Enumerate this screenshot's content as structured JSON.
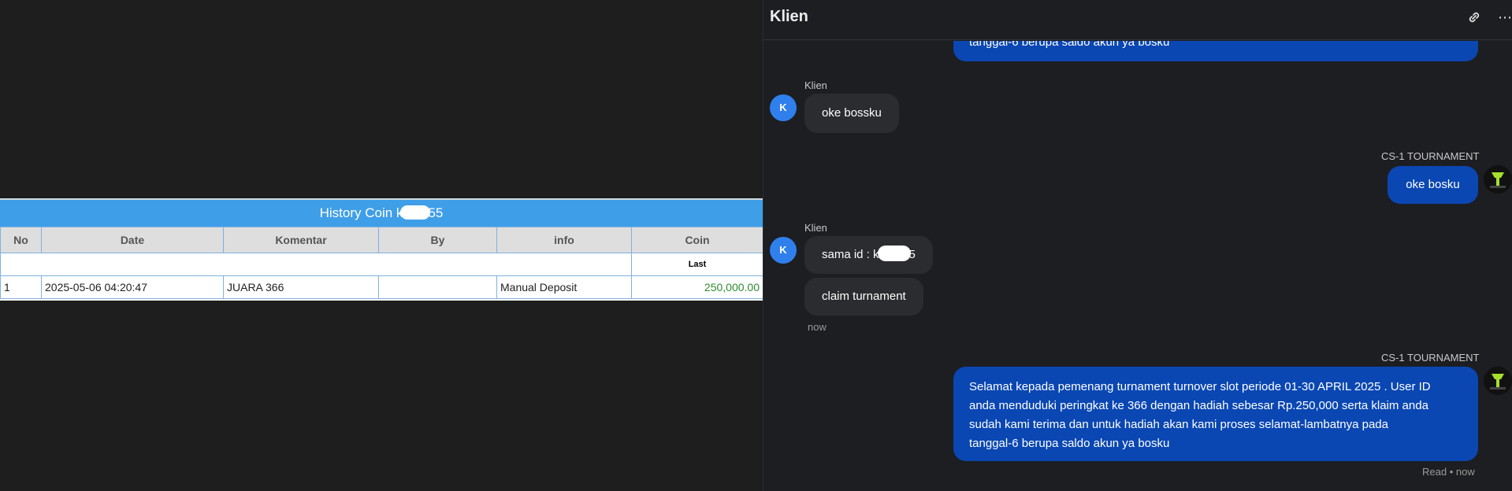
{
  "history": {
    "title_prefix": "History Coin k",
    "title_suffix": "55",
    "columns": [
      "No",
      "Date",
      "Komentar",
      "By",
      "info",
      "Coin"
    ],
    "subheader_last": "Last",
    "rows": [
      {
        "no": "1",
        "date": "2025-05-06 04:20:47",
        "komentar": "JUARA 366",
        "by": "",
        "info": "Manual Deposit",
        "coin": "250,000.00"
      }
    ]
  },
  "chat": {
    "title": "Klien",
    "messages": {
      "top_partial": "tanggal-6 berupa saldo akun ya bosku",
      "klien_name_1": "Klien",
      "klien_msg_1": "oke bossku",
      "agent_name_1": "CS-1 TOURNAMENT",
      "agent_msg_1": "oke bosku",
      "klien_name_2": "Klien",
      "klien_msg_2_prefix": "sama id : k",
      "klien_msg_2_suffix": "5",
      "klien_msg_3": "claim turnament",
      "klien_time": "now",
      "agent_name_2": "CS-1 TOURNAMENT",
      "agent_msg_2_line1": "Selamat kepada pemenang turnament turnover slot periode 01-30 APRIL 2025 . User ID",
      "agent_msg_2_line2": "anda menduduki peringkat ke 366 dengan hadiah sebesar Rp.250,000 serta klaim anda",
      "agent_msg_2_line3": "sudah kami terima dan untuk hadiah akan kami proses selamat-lambatnya pada",
      "agent_msg_2_line4": "tanggal-6 berupa saldo akun ya bosku",
      "read_status": "Read • now"
    },
    "avatar_initial": "K"
  },
  "colors": {
    "table_header": "#3f9ee8",
    "outgoing_bubble": "#0a47b3",
    "incoming_bubble": "#2b2c30",
    "avatar": "#2f80ed"
  }
}
